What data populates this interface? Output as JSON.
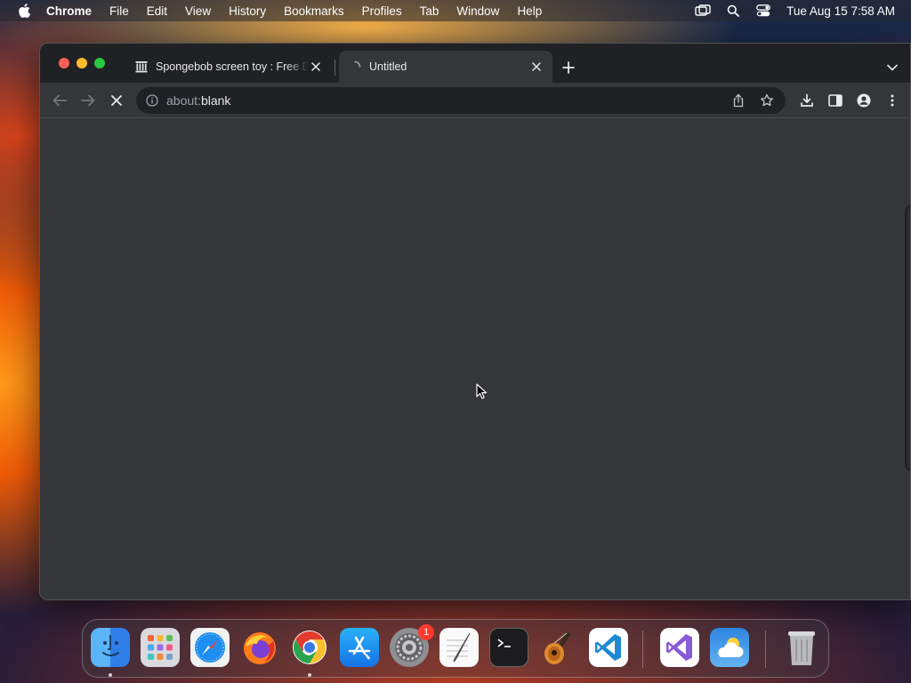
{
  "menubar": {
    "app_name": "Chrome",
    "items": [
      "File",
      "Edit",
      "View",
      "History",
      "Bookmarks",
      "Profiles",
      "Tab",
      "Window",
      "Help"
    ],
    "clock": "Tue Aug 15  7:58 AM",
    "status_icons": [
      "screen-mirroring-icon",
      "spotlight-search-icon",
      "control-center-icon"
    ]
  },
  "browser": {
    "tabs": [
      {
        "title": "Spongebob screen toy : Free D",
        "favicon": "archive-building-icon",
        "active": false
      },
      {
        "title": "Untitled",
        "favicon": "loading-spinner-icon",
        "active": true
      }
    ],
    "toolbar": {
      "url_scheme": "about:",
      "url_path": "blank",
      "loading": true
    },
    "theme": {
      "frame": "#202124",
      "toolbar": "#35363a",
      "omnibox": "#202124",
      "text": "#e8eaed"
    }
  },
  "dock": {
    "apps": [
      {
        "name": "Finder",
        "icon": "finder-icon",
        "running": true
      },
      {
        "name": "Launchpad",
        "icon": "launchpad-icon",
        "running": false
      },
      {
        "name": "Safari",
        "icon": "safari-icon",
        "running": false
      },
      {
        "name": "Firefox",
        "icon": "firefox-icon",
        "running": false
      },
      {
        "name": "Google Chrome",
        "icon": "chrome-icon",
        "running": true
      },
      {
        "name": "App Store",
        "icon": "app-store-icon",
        "running": false
      },
      {
        "name": "System Settings",
        "icon": "system-settings-icon",
        "running": false,
        "badge": "1"
      },
      {
        "name": "TextEdit",
        "icon": "textedit-icon",
        "running": false
      },
      {
        "name": "Terminal",
        "icon": "terminal-icon",
        "running": false
      },
      {
        "name": "GarageBand",
        "icon": "garageband-icon",
        "running": false
      },
      {
        "name": "Visual Studio Code",
        "icon": "vscode-icon",
        "running": false
      },
      {
        "name": "Visual Studio",
        "icon": "visual-studio-icon",
        "running": false
      },
      {
        "name": "Weather",
        "icon": "weather-icon",
        "running": false
      },
      {
        "name": "Trash",
        "icon": "trash-icon",
        "running": false
      }
    ]
  }
}
